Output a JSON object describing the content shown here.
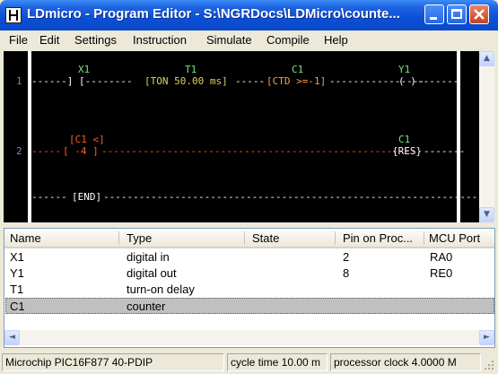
{
  "window": {
    "title": "LDmicro - Program Editor - S:\\NGRDocs\\LDMicro\\counte..."
  },
  "menu": [
    "File",
    "Edit",
    "Settings",
    "Instruction",
    "Simulate",
    "Compile",
    "Help"
  ],
  "ladder": {
    "rungs": [
      {
        "number": "1",
        "labels": {
          "x1": "X1",
          "t1": "T1",
          "c1": "C1",
          "y1": "Y1"
        },
        "segments": {
          "lead": "------] [--------",
          "ton": "[TON 50.00 ms]",
          "mid": "-----",
          "ctd": "[CTD >=-1]",
          "tail": "----------------",
          "coil": "( )",
          "end": "-------"
        }
      },
      {
        "number": "2",
        "labels": {
          "cmp": "[C1 <]",
          "c1": "C1"
        },
        "segments": {
          "lead": "-----",
          "cmp_val": "[ -4 ]",
          "wire": "-----------------------------------------------------",
          "res": "{RES}",
          "end": "-------"
        }
      },
      {
        "number": "",
        "segments": {
          "lead": "------",
          "end_block": "[END]",
          "tail": "------------------------------------------------------------------------"
        }
      }
    ]
  },
  "table": {
    "columns": [
      "Name",
      "Type",
      "State",
      "Pin on Proc...",
      "MCU Port"
    ],
    "rows": [
      {
        "name": "X1",
        "type": "digital in",
        "state": "",
        "pin": "2",
        "port": "RA0"
      },
      {
        "name": "Y1",
        "type": "digital out",
        "state": "",
        "pin": "8",
        "port": "RE0"
      },
      {
        "name": "T1",
        "type": "turn-on delay",
        "state": "",
        "pin": "",
        "port": ""
      },
      {
        "name": "C1",
        "type": "counter",
        "state": "",
        "pin": "",
        "port": ""
      }
    ],
    "selected_row": 3
  },
  "status": {
    "processor": "Microchip PIC16F877 40-PDIP",
    "cycle": "cycle time 10.00 m",
    "clock": "processor clock 4.0000 M"
  },
  "icons": {
    "scroll_up": "▲",
    "scroll_down": "▼",
    "scroll_left": "◄",
    "scroll_right": "►"
  }
}
